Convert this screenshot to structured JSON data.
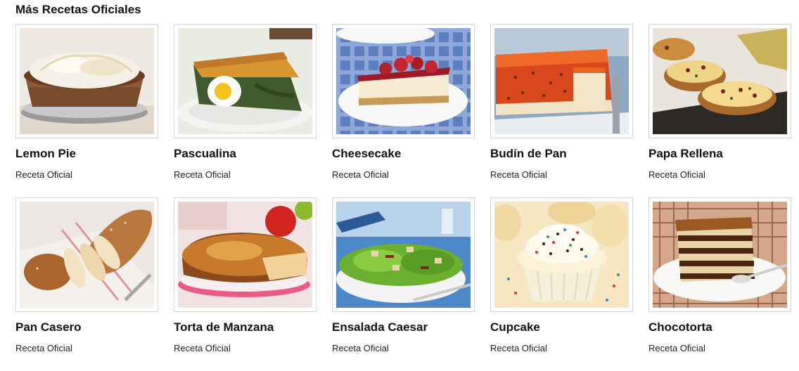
{
  "section": {
    "title": "Más Recetas Oficiales"
  },
  "recipes": [
    {
      "name": "Lemon Pie",
      "tag": "Receta Oficial",
      "image": "lemon-pie-photo"
    },
    {
      "name": "Pascualina",
      "tag": "Receta Oficial",
      "image": "pascualina-photo"
    },
    {
      "name": "Cheesecake",
      "tag": "Receta Oficial",
      "image": "cheesecake-photo"
    },
    {
      "name": "Budín de Pan",
      "tag": "Receta Oficial",
      "image": "budin-de-pan-photo"
    },
    {
      "name": "Papa Rellena",
      "tag": "Receta Oficial",
      "image": "papa-rellena-photo"
    },
    {
      "name": "Pan Casero",
      "tag": "Receta Oficial",
      "image": "pan-casero-photo"
    },
    {
      "name": "Torta de Manzana",
      "tag": "Receta Oficial",
      "image": "torta-de-manzana-photo"
    },
    {
      "name": "Ensalada Caesar",
      "tag": "Receta Oficial",
      "image": "ensalada-caesar-photo"
    },
    {
      "name": "Cupcake",
      "tag": "Receta Oficial",
      "image": "cupcake-photo"
    },
    {
      "name": "Chocotorta",
      "tag": "Receta Oficial",
      "image": "chocotorta-photo"
    }
  ]
}
